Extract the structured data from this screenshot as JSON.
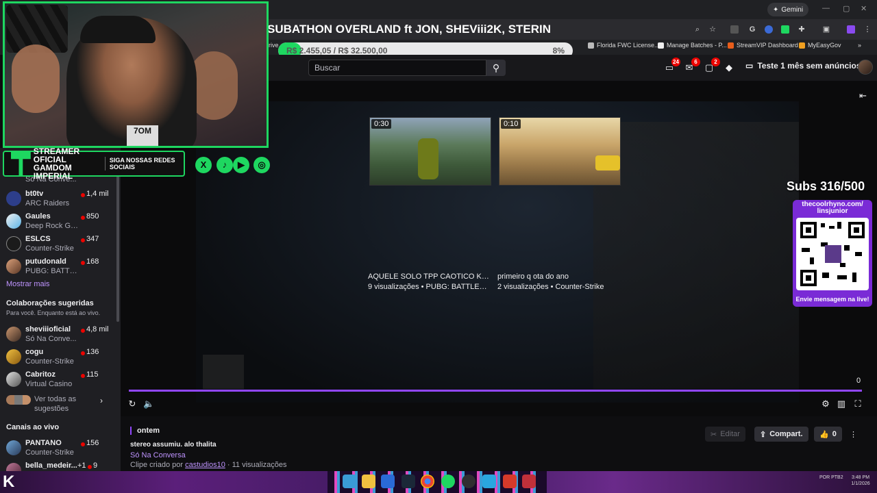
{
  "browser": {
    "tab_title": "SUBATHON OVERLAND ft JON, SHEViii2K, STERIN",
    "gemini_label": "Gemini",
    "bookmarks": [
      {
        "label": "Florida FWC License..."
      },
      {
        "label": "Manage Batches - P..."
      },
      {
        "label": "StreamVIP Dashboard"
      },
      {
        "label": "MyEasyGov"
      }
    ],
    "bookmark_partial": "rive"
  },
  "overlay": {
    "goal_text": "R$ 2.455,05 / R$ 32.500,00",
    "goal_percent_label": "8%",
    "goal_progress": 0.08,
    "banner_line1": "STREAMER OFICIAL GAMDOM IMPERIAL",
    "banner_line2": "SIGA NOSSAS REDES SOCIAIS",
    "webcam_logo": "7OM",
    "subs_text": "Subs 316/500",
    "qr_url": "thecoolrhyno.com/ linsjunior",
    "qr_message": "Envie mensagem na live!"
  },
  "nav": {
    "search_placeholder": "Buscar",
    "badge_1": "24",
    "badge_2": "6",
    "badge_3": "2",
    "trial_label": "Teste 1 mês sem anúncios"
  },
  "sidebar": {
    "channels_top": [
      {
        "name": "",
        "game": "Só Na Conve..."
      },
      {
        "name": "bt0tv",
        "game": "ARC Raiders",
        "viewers": "1,4 mil"
      },
      {
        "name": "Gaules",
        "game": "Deep Rock Gal...",
        "viewers": "850"
      },
      {
        "name": "ESLCS",
        "game": "Counter-Strike",
        "viewers": "347"
      },
      {
        "name": "putudonald",
        "game": "PUBG: BATTLE...",
        "viewers": "168"
      }
    ],
    "show_more": "Mostrar mais",
    "suggested_title": "Colaborações sugeridas",
    "suggested_sub": "Para você. Enquanto está ao vivo.",
    "suggested": [
      {
        "name": "sheviiioficial",
        "game": "Só Na Conve...",
        "viewers": "4,8 mil"
      },
      {
        "name": "cogu",
        "game": "Counter-Strike",
        "viewers": "136"
      },
      {
        "name": "Cabritoz",
        "game": "Virtual Casino",
        "viewers": "115"
      }
    ],
    "see_all": "Ver todas as sugestões",
    "live_title": "Canais ao vivo",
    "live": [
      {
        "name": "PANTANO",
        "game": "Counter-Strike",
        "viewers": "156"
      },
      {
        "name": "bella_medeir...",
        "extra": "+1",
        "viewers": "9"
      }
    ]
  },
  "player": {
    "clips": [
      {
        "duration": "0:30",
        "title": "AQUELE SOLO TPP CAOTICO KKK !...",
        "meta": "9 visualizações • PUBG: BATTLEGR..."
      },
      {
        "duration": "0:10",
        "title": "primeiro q ota do ano",
        "meta": "2 visualizações • Counter-Strike"
      }
    ],
    "time_display": "0"
  },
  "info": {
    "date": "ontem",
    "title": "stereo assumiu. alo thalita",
    "category": "Só Na Conversa",
    "creator_prefix": "Clipe criado por",
    "creator": "castudios10",
    "views": " · 11 visualizações",
    "edit_label": "Editar",
    "share_label": "Compart.",
    "like_count": "0"
  },
  "taskbar": {
    "lang": "POR PTB2",
    "time": "3:48 PM 1/1/2026"
  },
  "colors": {
    "accent": "#9147ff",
    "webcam_border": "#1ed760",
    "live": "#eb0400"
  }
}
